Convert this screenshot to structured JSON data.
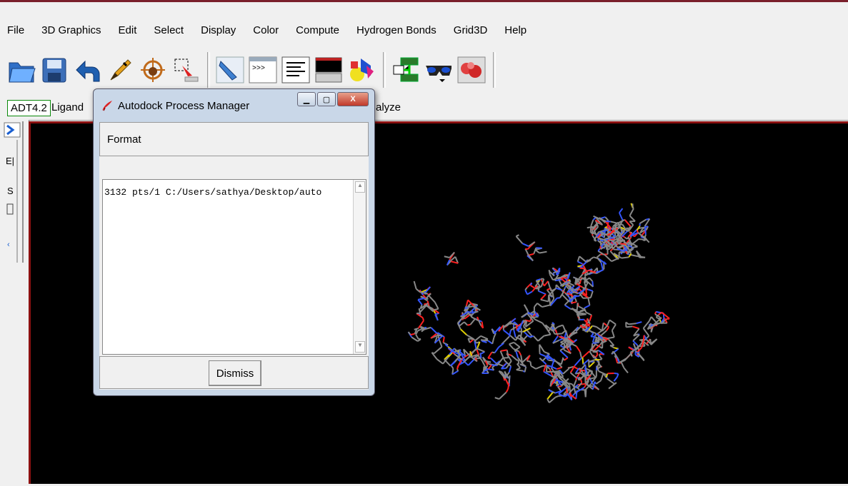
{
  "menu": [
    "File",
    "3D Graphics",
    "Edit",
    "Select",
    "Display",
    "Color",
    "Compute",
    "Hydrogen Bonds",
    "Grid3D",
    "Help"
  ],
  "toolbar": {
    "icons": [
      "open-icon",
      "save-icon",
      "undo-icon",
      "pencil-icon",
      "target-icon",
      "selection-icon",
      "pointer-icon",
      "python-shell-icon",
      "text-align-icon",
      "monitor-icon",
      "shapes-icon",
      "network-icon",
      "stereo-glasses-icon",
      "molecule-icon"
    ]
  },
  "tabs": {
    "adt": "ADT4.2",
    "ligand": "Ligand",
    "analyze": "alyze"
  },
  "dialog": {
    "title": "Autodock Process Manager",
    "format": "Format",
    "process_line": "3132  pts/1 C:/Users/sathya/Desktop/auto",
    "dismiss": "Dismiss"
  },
  "colors": {
    "viewer_bg": "#000000",
    "viewer_border": "#8b1010",
    "dialog_frame": "#c9d7e8",
    "close_button": "#c0392b",
    "atom_carbon": "#888888",
    "atom_nitrogen": "#3355ff",
    "atom_oxygen": "#ff2020",
    "atom_sulfur": "#e0d000"
  }
}
